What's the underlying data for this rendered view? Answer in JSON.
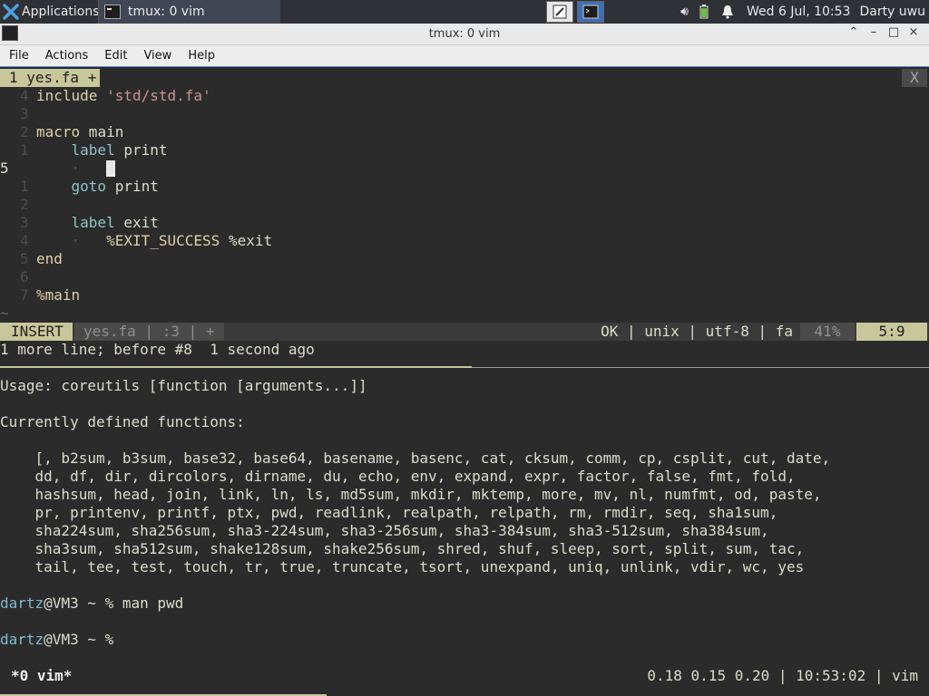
{
  "panel": {
    "applications_label": "Applications",
    "task_label": "tmux: 0 vim",
    "clock": "Wed  6 Jul, 10:53",
    "user": "Darty uwu"
  },
  "window": {
    "title": "tmux: 0 vim"
  },
  "menu": [
    "File",
    "Actions",
    "Edit",
    "View",
    "Help"
  ],
  "vim": {
    "tab_label": "1 yes.fa +",
    "tab_close": "X",
    "lines": [
      {
        "num": "4",
        "text": "include 'std/std.fa'"
      },
      {
        "num": "3",
        "text": ""
      },
      {
        "num": "2",
        "text": "macro main"
      },
      {
        "num": "1",
        "text": "    label print"
      },
      {
        "num": "5",
        "text": ""
      },
      {
        "num": "1",
        "text": "    goto print"
      },
      {
        "num": "2",
        "text": ""
      },
      {
        "num": "3",
        "text": "    label exit"
      },
      {
        "num": "4",
        "text": "        %EXIT_SUCCESS %exit"
      },
      {
        "num": "5",
        "text": "end"
      },
      {
        "num": "6",
        "text": ""
      },
      {
        "num": "7",
        "text": "%main"
      }
    ],
    "tilde": "~",
    "status": {
      "mode": "INSERT",
      "file": "yes.fa  |  :3  |  +",
      "info": "OK  |  unix  |  utf-8  |  fa",
      "percent": "41%",
      "position": "5:9"
    },
    "message": "1 more line; before #8  1 second ago"
  },
  "shell": {
    "usage": "Usage: coreutils [function [arguments...]]",
    "defined": "Currently defined functions:",
    "functions": [
      "    [, b2sum, b3sum, base32, base64, basename, basenc, cat, cksum, comm, cp, csplit, cut, date,",
      "    dd, df, dir, dircolors, dirname, du, echo, env, expand, expr, factor, false, fmt, fold,",
      "    hashsum, head, join, link, ln, ls, md5sum, mkdir, mktemp, more, mv, nl, numfmt, od, paste,",
      "    pr, printenv, printf, ptx, pwd, readlink, realpath, relpath, rm, rmdir, seq, sha1sum,",
      "    sha224sum, sha256sum, sha3-224sum, sha3-256sum, sha3-384sum, sha3-512sum, sha384sum,",
      "    sha3sum, sha512sum, shake128sum, shake256sum, shred, shuf, sleep, sort, split, sum, tac,",
      "    tail, tee, test, touch, tr, true, truncate, tsort, unexpand, uniq, unlink, vdir, wc, yes"
    ],
    "prompt_user": "dartz",
    "prompt_rest": "@VM3 ~ % ",
    "cmd1": "man pwd",
    "cmd2": ""
  },
  "tmux": {
    "window": "*0 vim*",
    "right": "0.18 0.15 0.20  |  10:53:02  |  vim"
  }
}
